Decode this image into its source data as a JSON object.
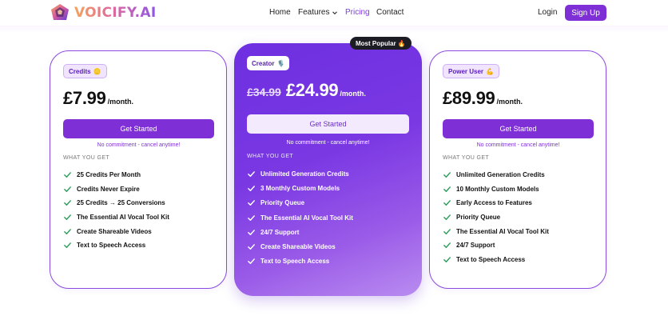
{
  "header": {
    "brand": "VOICIFY.AI",
    "nav": {
      "home": "Home",
      "features": "Features",
      "pricing": "Pricing",
      "contact": "Contact"
    },
    "login": "Login",
    "signup": "Sign Up"
  },
  "plans": [
    {
      "name": "Credits",
      "name_emoji": "🪙",
      "price": "£7.99",
      "period": "/month.",
      "cta": "Get Started",
      "note": "No commitment - cancel anytime!",
      "features_heading": "WHAT YOU GET",
      "features": [
        "25 Credits Per Month",
        "Credits Never Expire",
        "25 Credits → 25 Conversions",
        "The Essential AI Vocal Tool Kit",
        "Create Shareable Videos",
        "Text to Speech Access"
      ]
    },
    {
      "name": "Creator",
      "name_emoji": "🎙️",
      "popular": "Most Popular",
      "popular_emoji": "🔥",
      "old_price": "£34.99",
      "price": "£24.99",
      "period": "/month.",
      "cta": "Get Started",
      "note": "No commitment - cancel anytime!",
      "features_heading": "WHAT YOU GET",
      "features": [
        "Unlimited Generation Credits",
        "3 Monthly Custom Models",
        "Priority Queue",
        "The Essential AI Vocal Tool Kit",
        "24/7 Support",
        "Create Shareable Videos",
        "Text to Speech Access"
      ]
    },
    {
      "name": "Power User",
      "name_emoji": "💪",
      "price": "£89.99",
      "period": "/month.",
      "cta": "Get Started",
      "note": "No commitment - cancel anytime!",
      "features_heading": "WHAT YOU GET",
      "features": [
        "Unlimited Generation Credits",
        "10 Monthly Custom Models",
        "Early Access to Features",
        "Priority Queue",
        "The Essential AI Vocal Tool Kit",
        "24/7 Support",
        "Text to Speech Access"
      ]
    }
  ],
  "colors": {
    "brand_purple": "#7e2fd6",
    "check_green": "#2e9e5b",
    "popular_bg": "#1c1c24"
  },
  "icons": {
    "logo": "voicify-logo-icon",
    "features_menu": "chevron-down-icon",
    "feature_item": "check-icon"
  }
}
